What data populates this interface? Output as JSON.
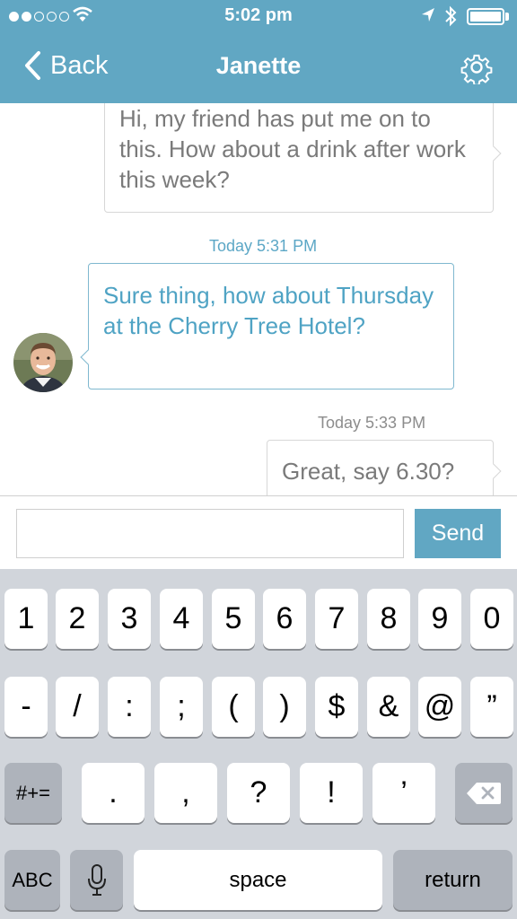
{
  "status_bar": {
    "time": "5:02 pm",
    "signal_icon": "signal-dots-icon",
    "wifi_icon": "wifi-icon",
    "location_icon": "location-arrow-icon",
    "bluetooth_icon": "bluetooth-icon",
    "battery_icon": "battery-icon"
  },
  "nav": {
    "back_label": "Back",
    "title": "Janette",
    "settings_icon": "gear-icon"
  },
  "messages": [
    {
      "text": "Hi, my friend has put me on to this. How about a drink after work this week?",
      "side": "right"
    },
    {
      "timestamp": "Today 5:31 PM",
      "text": "Sure thing, how about Thursday at the Cherry Tree Hotel?",
      "side": "left"
    },
    {
      "timestamp": "Today 5:33 PM",
      "text": "Great, say 6.30?",
      "side": "right"
    }
  ],
  "input": {
    "value": "",
    "placeholder": "",
    "send_label": "Send"
  },
  "keyboard": {
    "row1": [
      "1",
      "2",
      "3",
      "4",
      "5",
      "6",
      "7",
      "8",
      "9",
      "0"
    ],
    "row2": [
      "-",
      "/",
      ":",
      ";",
      "(",
      ")",
      "$",
      "&",
      "@",
      "”"
    ],
    "row3": {
      "shift_label": "#+=",
      "keys": [
        ".",
        ",",
        "?",
        "!",
        "’"
      ],
      "delete_icon": "backspace-icon"
    },
    "row4": {
      "abc_label": "ABC",
      "mic_icon": "microphone-icon",
      "space_label": "space",
      "return_label": "return"
    }
  },
  "colors": {
    "accent": "#61a7c3",
    "incoming_text": "#4fa3c4",
    "outgoing_text": "#7a7a7a",
    "keyboard_bg": "#d1d5db"
  }
}
